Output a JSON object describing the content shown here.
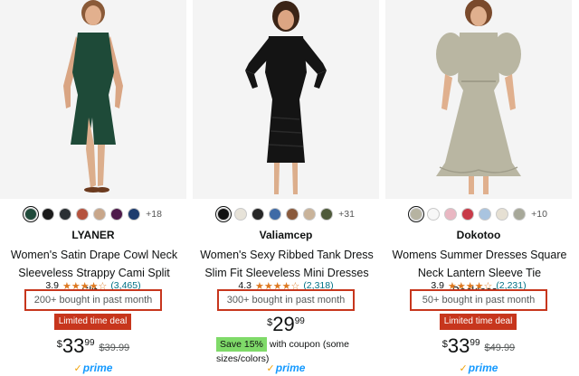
{
  "products": [
    {
      "brand": "LYANER",
      "title_line1": "Women's Satin Drape Cowl Neck",
      "title_line2": "Sleeveless Strappy Cami Split Slit...",
      "rating": "3.9",
      "stars": "★★★★☆",
      "rating_count": "(3,465)",
      "bought": "200+ bought in past month",
      "deal": "Limited time deal",
      "currency": "$",
      "price_whole": "33",
      "price_cents": "99",
      "list_price": "$39.99",
      "prime": "prime",
      "more_colors": "+18",
      "colors": [
        "#1f4a3a",
        "#1b1b1b",
        "#2a2f33",
        "#b5533e",
        "#c8a68a",
        "#4d1a4a",
        "#1d3c6e"
      ],
      "dress_color": "#1e4a38"
    },
    {
      "brand": "Valiamcep",
      "title_line1": "Women's Sexy Ribbed Tank Dress",
      "title_line2": "Slim Fit Sleeveless Mini Dresses",
      "rating": "4.3",
      "stars": "★★★★☆",
      "rating_count": "(2,318)",
      "bought": "300+ bought in past month",
      "currency": "$",
      "price_whole": "29",
      "price_cents": "99",
      "coupon_badge": "Save 15%",
      "coupon_text": "with coupon (some sizes/colors)",
      "prime": "prime",
      "more_colors": "+31",
      "colors": [
        "#111111",
        "#e7e3d9",
        "#262626",
        "#3f6aa6",
        "#8a5a3c",
        "#c9b39a",
        "#4e5a3a"
      ],
      "dress_color": "#141414"
    },
    {
      "brand": "Dokotoo",
      "title_line1": "Womens Summer Dresses Square",
      "title_line2": "Neck Lantern Sleeve Tie Backless...",
      "rating": "3.9",
      "stars": "★★★★☆",
      "rating_count": "(2,231)",
      "bought": "50+ bought in past month",
      "deal": "Limited time deal",
      "currency": "$",
      "price_whole": "33",
      "price_cents": "99",
      "list_price": "$49.99",
      "prime": "prime",
      "more_colors": "+10",
      "colors": [
        "#b6b3a1",
        "#f7f7f7",
        "#e9b7c2",
        "#c83a48",
        "#a9c4e0",
        "#e6e0d3",
        "#a7a899"
      ],
      "dress_color": "#b9b6a2"
    }
  ]
}
